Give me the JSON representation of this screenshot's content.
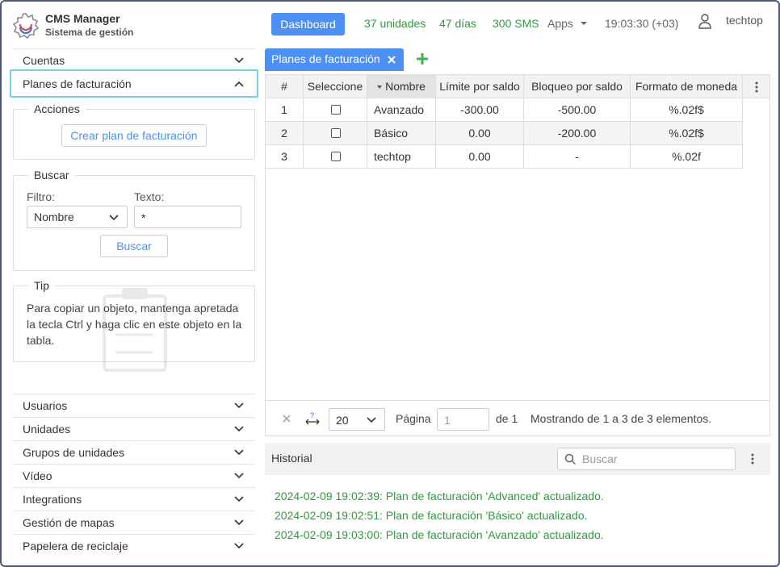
{
  "app": {
    "title": "CMS Manager",
    "subtitle": "Sistema de gestión"
  },
  "header": {
    "dashboard_label": "Dashboard",
    "units": "37 unidades",
    "days": "47 días",
    "sms": "300 SMS",
    "apps_label": "Apps",
    "time": "19:03:30 (+03)",
    "user": "techtop"
  },
  "sidebar": {
    "top_items": [
      {
        "label": "Cuentas"
      },
      {
        "label": "Planes de facturación"
      }
    ],
    "actions": {
      "legend": "Acciones",
      "create_label": "Crear plan de facturación"
    },
    "search": {
      "legend": "Buscar",
      "filter_label": "Filtro:",
      "text_label": "Texto:",
      "filter_value": "Nombre",
      "text_value": "*",
      "button_label": "Buscar"
    },
    "tip": {
      "legend": "Tip",
      "text": "Para copiar un objeto, mantenga apretada la tecla Ctrl y haga clic en este objeto en la tabla."
    },
    "bottom_items": [
      {
        "label": "Usuarios"
      },
      {
        "label": "Unidades"
      },
      {
        "label": "Grupos de unidades"
      },
      {
        "label": "Vídeo"
      },
      {
        "label": "Integrations"
      },
      {
        "label": "Gestión de mapas"
      },
      {
        "label": "Papelera de reciclaje"
      }
    ]
  },
  "tabs": [
    {
      "label": "Planes de facturación"
    }
  ],
  "grid": {
    "columns": [
      "#",
      "Seleccione",
      "Nombre",
      "Límite por saldo",
      "Bloqueo por saldo",
      "Formato de moneda"
    ],
    "sorted_column": "Nombre",
    "rows": [
      {
        "num": "1",
        "name": "Avanzado",
        "limit": "-300.00",
        "block": "-500.00",
        "format": "%.02f$"
      },
      {
        "num": "2",
        "name": "Básico",
        "limit": "0.00",
        "block": "-200.00",
        "format": "%.02f$"
      },
      {
        "num": "3",
        "name": "techtop",
        "limit": "0.00",
        "block": "-",
        "format": "%.02f"
      }
    ]
  },
  "pager": {
    "page_size": "20",
    "page_label": "Página",
    "page_value": "1",
    "of_label": "de 1",
    "summary": "Mostrando de 1 a 3 de 3 elementos."
  },
  "history": {
    "title": "Historial",
    "search_placeholder": "Buscar",
    "entries": [
      "2024-02-09 19:02:39: Plan de facturación 'Advanced' actualizado.",
      "2024-02-09 19:02:51: Plan de facturación 'Básico' actualizado.",
      "2024-02-09 19:03:00: Plan de facturación 'Avanzado' actualizado."
    ]
  },
  "colors": {
    "accent": "#4d8ff2",
    "success": "#2e9a3e",
    "focus": "#6ed1e6",
    "add": "#3cb54a"
  }
}
